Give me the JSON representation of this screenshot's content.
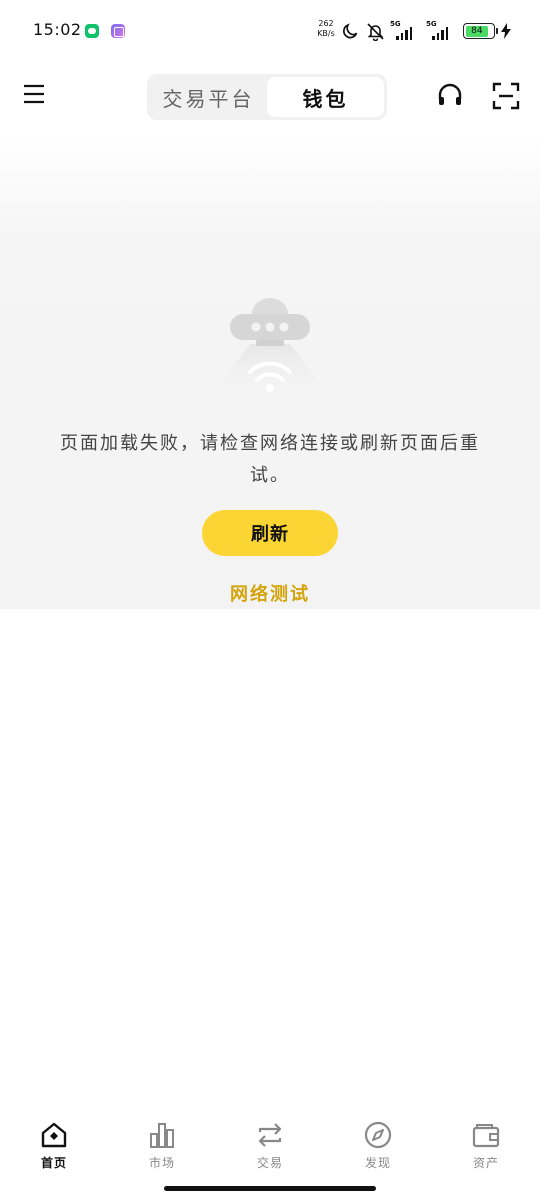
{
  "status_bar": {
    "time": "15:02",
    "speed_value": "262",
    "speed_unit": "KB/s",
    "network_1": "5G",
    "network_2": "5G",
    "battery": "84",
    "icons": [
      "wechat-icon",
      "game-icon",
      "moon-icon",
      "bell-off-icon",
      "signal-icon",
      "battery-icon",
      "charging-icon"
    ]
  },
  "header": {
    "tabs": [
      {
        "label": "交易平台",
        "active": false
      },
      {
        "label": "钱包",
        "active": true
      }
    ],
    "icons": [
      "menu-icon",
      "headset-icon",
      "scan-icon"
    ]
  },
  "error": {
    "message": "页面加载失败，请检查网络连接或刷新页面后重试。",
    "refresh_label": "刷新",
    "network_test_label": "网络测试"
  },
  "bottom_nav": {
    "items": [
      {
        "label": "首页",
        "icon": "home-icon",
        "active": true
      },
      {
        "label": "市场",
        "icon": "chart-icon",
        "active": false
      },
      {
        "label": "交易",
        "icon": "swap-icon",
        "active": false
      },
      {
        "label": "发现",
        "icon": "compass-icon",
        "active": false
      },
      {
        "label": "资产",
        "icon": "wallet-icon",
        "active": false
      }
    ]
  },
  "colors": {
    "accent": "#fbd534",
    "link": "#d4a40c",
    "panel_bg": "#f3f3f3"
  }
}
